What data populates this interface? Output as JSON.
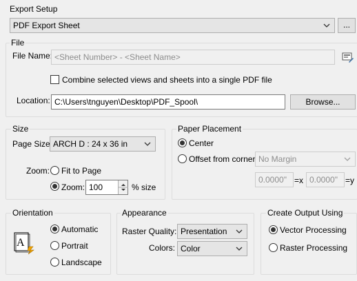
{
  "export_setup": {
    "title": "Export Setup",
    "selected": "PDF Export Sheet",
    "more_label": "..."
  },
  "file": {
    "title": "File",
    "name_label": "File Name:",
    "name_value": "<Sheet Number> - <Sheet Name>",
    "edit_icon": "edit-name-icon",
    "combine_label": "Combine selected views and sheets into a single PDF file",
    "combine_checked": false,
    "location_label": "Location:",
    "location_value": "C:\\Users\\tnguyen\\Desktop\\PDF_Spool\\",
    "browse_label": "Browse..."
  },
  "size": {
    "title": "Size",
    "page_size_label": "Page Size:",
    "page_size_value": "ARCH D : 24 x 36 in",
    "zoom_label": "Zoom:",
    "fit_to_page_label": "Fit to Page",
    "zoom_option_label": "Zoom:",
    "zoom_value": "100",
    "percent_size_label": "% size",
    "selected_zoom_mode": "zoom"
  },
  "paper_placement": {
    "title": "Paper Placement",
    "center_label": "Center",
    "offset_label": "Offset from corner:",
    "offset_value": "No Margin",
    "x_value": "0.0000\"",
    "x_suffix": "=x",
    "y_value": "0.0000\"",
    "y_suffix": "=y",
    "selected": "center"
  },
  "orientation": {
    "title": "Orientation",
    "icon": "page-orientation-icon",
    "automatic_label": "Automatic",
    "portrait_label": "Portrait",
    "landscape_label": "Landscape",
    "selected": "automatic"
  },
  "appearance": {
    "title": "Appearance",
    "raster_quality_label": "Raster Quality:",
    "raster_quality_value": "Presentation",
    "colors_label": "Colors:",
    "colors_value": "Color"
  },
  "create_output": {
    "title": "Create Output Using",
    "vector_label": "Vector Processing",
    "raster_label": "Raster Processing",
    "selected": "vector"
  }
}
